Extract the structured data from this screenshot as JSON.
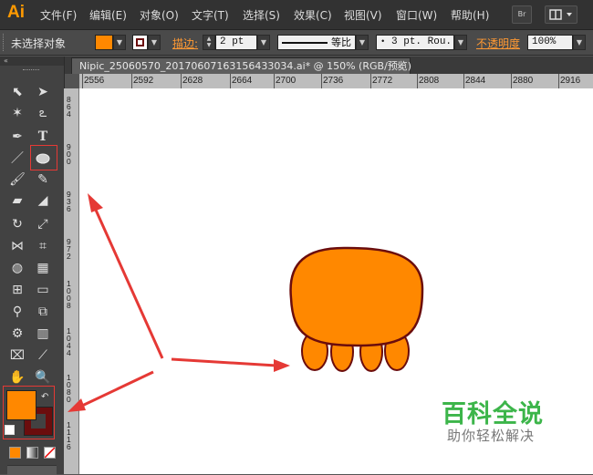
{
  "app": {
    "logo": "Ai"
  },
  "menubar": {
    "items": [
      "文件(F)",
      "编辑(E)",
      "对象(O)",
      "文字(T)",
      "选择(S)",
      "效果(C)",
      "视图(V)",
      "窗口(W)",
      "帮助(H)"
    ],
    "bridge_label": "Br"
  },
  "control_bar": {
    "selection_status": "未选择对象",
    "stroke_label": "描边:",
    "stroke_weight": "2 pt",
    "profile_label": "等比",
    "brush_label": "3 pt. Rou...",
    "opacity_label": "不透明度",
    "opacity_value": "100%"
  },
  "document": {
    "tab_title": "Nipic_25060570_20170607163156433034.ai* @ 150% (RGB/预览)",
    "close_label": "×"
  },
  "ruler": {
    "horizontal": [
      "2556",
      "2592",
      "2628",
      "2664",
      "2700",
      "2736",
      "2772",
      "2808",
      "2844",
      "2880",
      "2916"
    ],
    "vertical": [
      "864",
      "900",
      "936",
      "972",
      "1008",
      "1044",
      "1080",
      "1116"
    ]
  },
  "colors": {
    "fill": "#ff8800",
    "stroke": "#6b0d0d",
    "annotation_red": "#e53935",
    "canvas_bg": "#ffffff"
  },
  "watermark": {
    "title": "百科全说",
    "subtitle": "助你轻松解决"
  }
}
